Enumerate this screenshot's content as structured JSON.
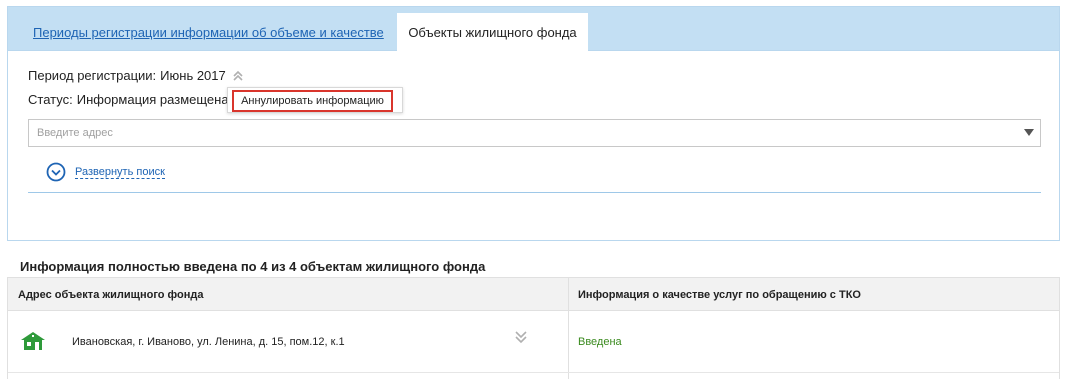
{
  "tabs": {
    "periods_label": "Периоды регистрации информации об объеме и качестве",
    "objects_label": "Объекты жилищного фонда"
  },
  "period": {
    "label": "Период регистрации:",
    "value": "Июнь 2017"
  },
  "status": {
    "label": "Статус:",
    "value": "Информация размещена"
  },
  "menu": {
    "annul_label": "Аннулировать информацию"
  },
  "search": {
    "placeholder": "Введите адрес",
    "expand_label": "Развернуть поиск"
  },
  "summary": {
    "title": "Информация полностью введена по 4 из 4 объектам жилищного фонда"
  },
  "table": {
    "headers": [
      "Адрес объекта жилищного фонда",
      "Информация о качестве услуг по обращению с ТКО"
    ],
    "rows": [
      {
        "address": "Ивановская, г. Иваново, ул. Ленина, д. 15, пом.12, к.1",
        "status": "Введена"
      }
    ]
  },
  "colors": {
    "accent": "#1e64b4",
    "tab_bar": "#c3dff3",
    "highlight": "#d9352c",
    "status_green": "#3a8a1e",
    "house_green": "#2e9a3a"
  },
  "icons": {
    "period_toggle": "double-chevron-up-icon",
    "expand_search": "circle-chevron-down-icon",
    "house": "house-icon",
    "row_expand": "double-chevron-down-icon"
  }
}
